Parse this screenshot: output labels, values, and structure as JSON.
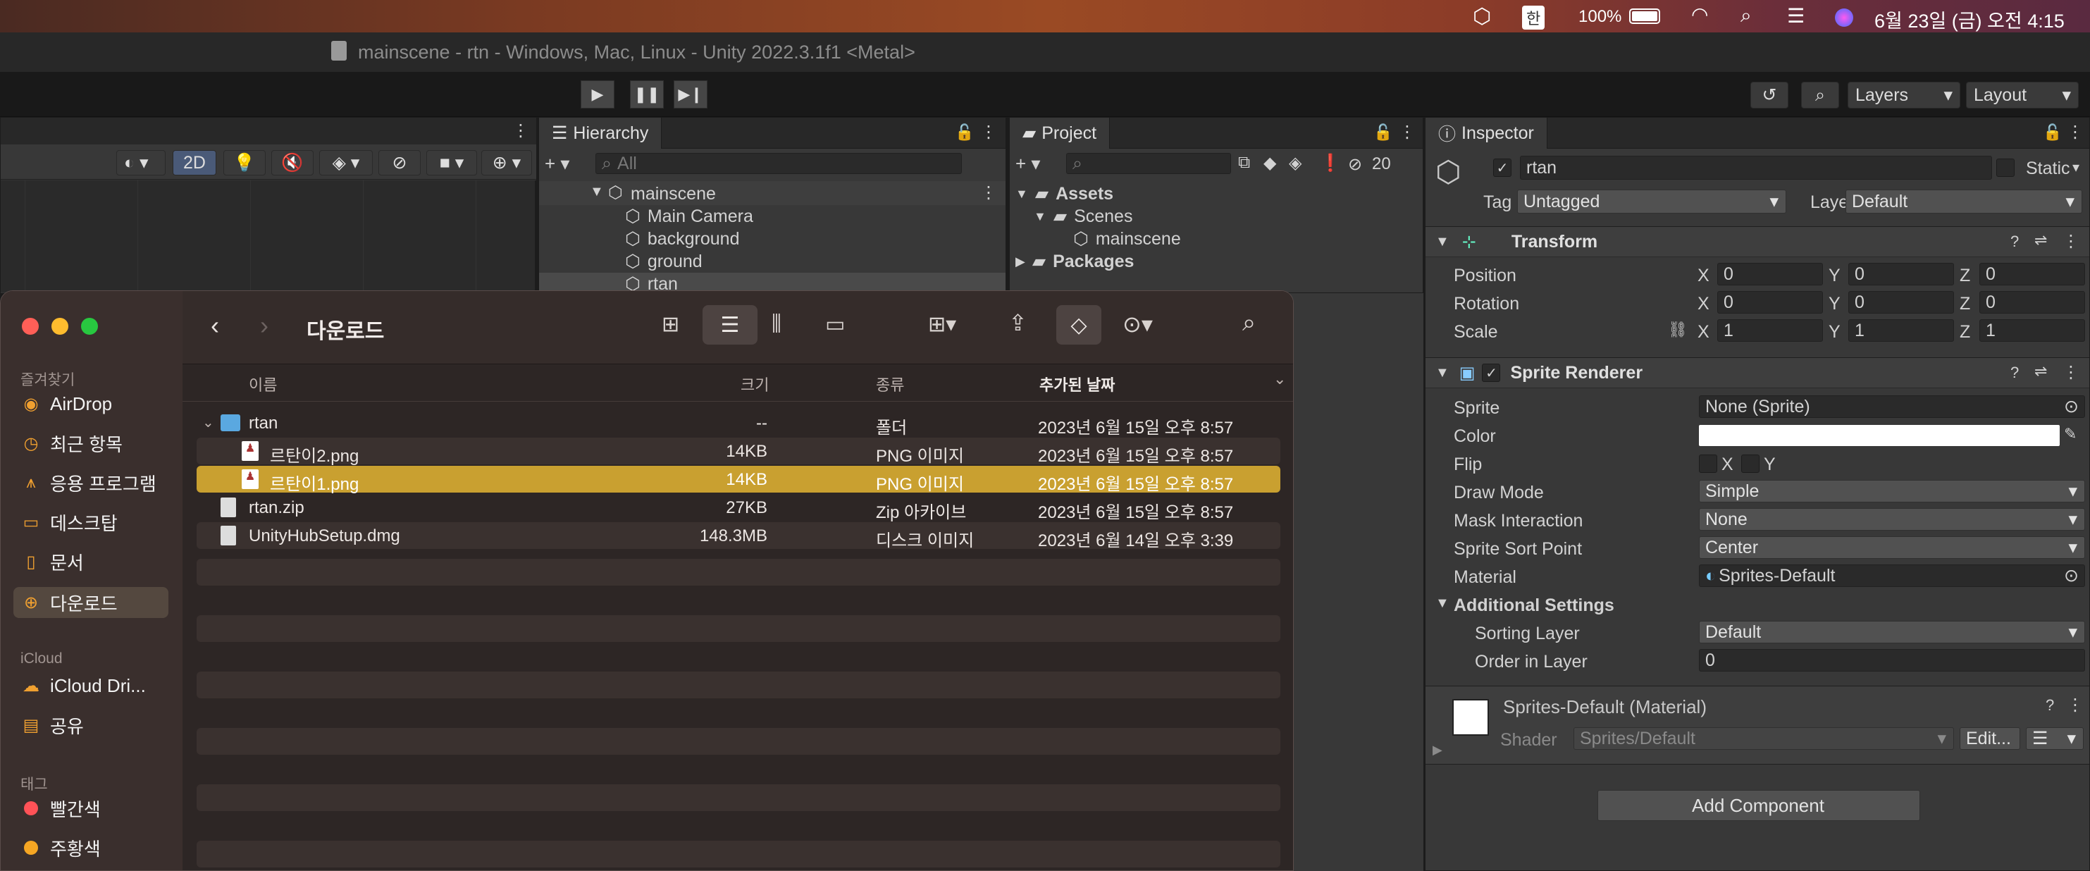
{
  "menubar": {
    "battery": "100%",
    "ime": "한",
    "datetime": "6월 23일 (금) 오전 4:15",
    "icons": [
      "unity-icon",
      "ime-icon",
      "battery-icon",
      "wifi-icon",
      "search-icon",
      "control-center-icon",
      "siri-icon"
    ]
  },
  "window_title": "mainscene - rtn - Windows, Mac, Linux - Unity 2022.3.1f1 <Metal>",
  "toolbar": {
    "layers_label": "Layers",
    "layout_label": "Layout",
    "mode_2d": "2D"
  },
  "hierarchy": {
    "tab": "Hierarchy",
    "search_placeholder": "All",
    "scene": "mainscene",
    "items": [
      "Main Camera",
      "background",
      "ground",
      "rtan"
    ]
  },
  "project": {
    "tab": "Project",
    "hidden_count": "20",
    "tree": [
      "Assets",
      "Scenes",
      "mainscene",
      "Packages"
    ]
  },
  "inspector": {
    "tab": "Inspector",
    "object_name": "rtan",
    "static_label": "Static",
    "tag_label": "Tag",
    "tag_value": "Untagged",
    "layer_label": "Layer",
    "layer_value": "Default",
    "transform": {
      "title": "Transform",
      "rows": [
        {
          "label": "Position",
          "x": "0",
          "y": "0",
          "z": "0"
        },
        {
          "label": "Rotation",
          "x": "0",
          "y": "0",
          "z": "0"
        },
        {
          "label": "Scale",
          "x": "1",
          "y": "1",
          "z": "1"
        }
      ],
      "axis_x": "X",
      "axis_y": "Y",
      "axis_z": "Z"
    },
    "sprite_renderer": {
      "title": "Sprite Renderer",
      "sprite_label": "Sprite",
      "sprite_value": "None (Sprite)",
      "color_label": "Color",
      "flip_label": "Flip",
      "flip_x": "X",
      "flip_y": "Y",
      "draw_mode_label": "Draw Mode",
      "draw_mode_value": "Simple",
      "mask_label": "Mask Interaction",
      "mask_value": "None",
      "sort_point_label": "Sprite Sort Point",
      "sort_point_value": "Center",
      "material_label": "Material",
      "material_value": "Sprites-Default",
      "additional": "Additional Settings",
      "sorting_layer_label": "Sorting Layer",
      "sorting_layer_value": "Default",
      "order_label": "Order in Layer",
      "order_value": "0"
    },
    "material_block": {
      "title": "Sprites-Default (Material)",
      "shader_label": "Shader",
      "shader_value": "Sprites/Default",
      "edit_label": "Edit..."
    },
    "add_component": "Add Component"
  },
  "finder": {
    "title": "다운로드",
    "sidebar": {
      "favorites_header": "즐겨찾기",
      "favorites": [
        "AirDrop",
        "최근 항목",
        "응용 프로그램",
        "데스크탑",
        "문서",
        "다운로드"
      ],
      "icloud_header": "iCloud",
      "icloud": [
        "iCloud Dri...",
        "공유"
      ],
      "tags_header": "태그",
      "tags": [
        {
          "name": "빨간색",
          "color": "#ff5257"
        },
        {
          "name": "주황색",
          "color": "#f5a623"
        }
      ]
    },
    "columns": {
      "name": "이름",
      "size": "크기",
      "kind": "종류",
      "date": "추가된 날짜"
    },
    "files": [
      {
        "name": "rtan",
        "size": "--",
        "kind": "폴더",
        "date": "2023년 6월 15일 오후 8:57"
      },
      {
        "name": "르탄이2.png",
        "size": "14KB",
        "kind": "PNG 이미지",
        "date": "2023년 6월 15일 오후 8:57"
      },
      {
        "name": "르탄이1.png",
        "size": "14KB",
        "kind": "PNG 이미지",
        "date": "2023년 6월 15일 오후 8:57"
      },
      {
        "name": "rtan.zip",
        "size": "27KB",
        "kind": "Zip 아카이브",
        "date": "2023년 6월 15일 오후 8:57"
      },
      {
        "name": "UnityHubSetup.dmg",
        "size": "148.3MB",
        "kind": "디스크 이미지",
        "date": "2023년 6월 14일 오후 3:39"
      }
    ],
    "selected_color": "#c9a030"
  }
}
